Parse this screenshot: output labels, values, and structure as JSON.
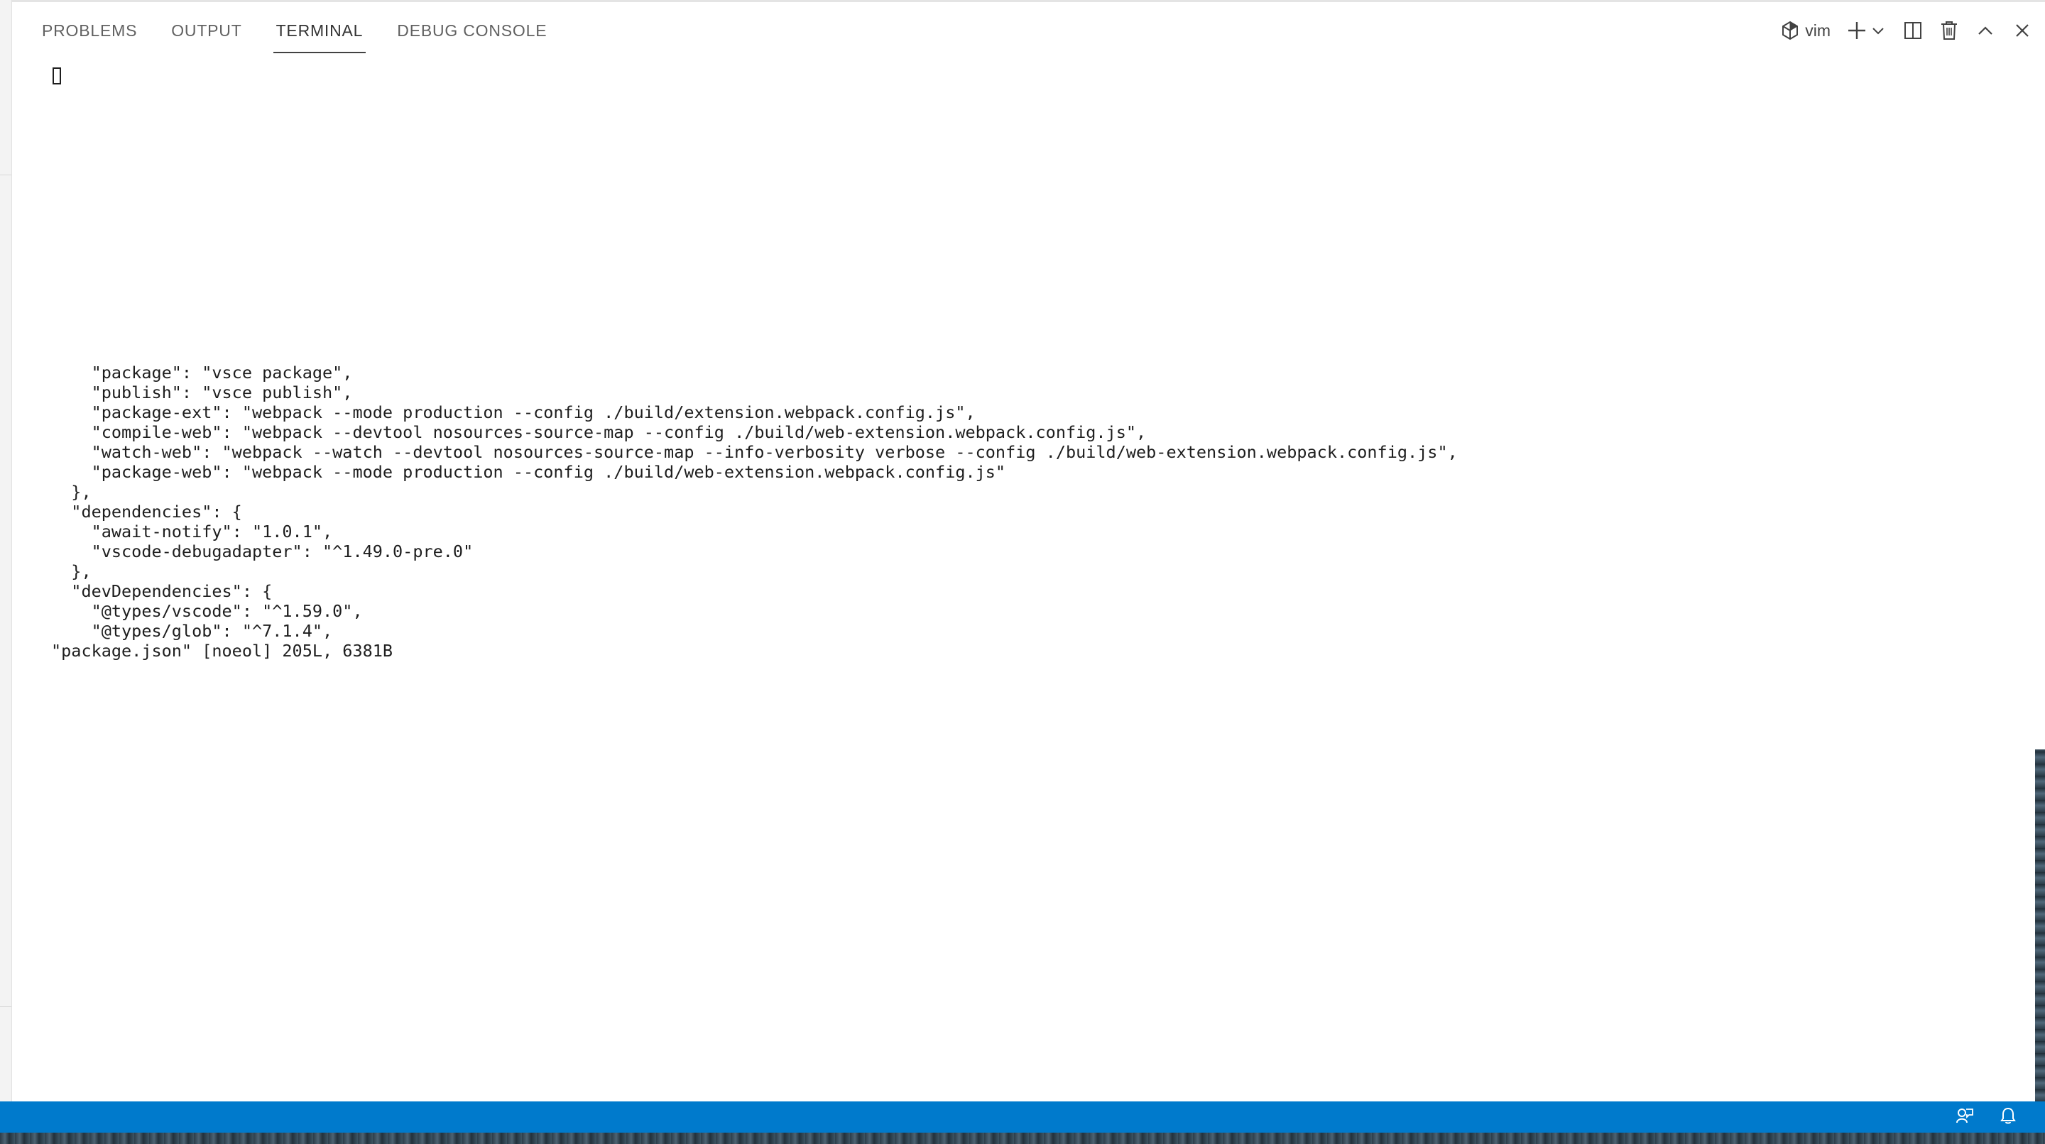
{
  "panel": {
    "tabs": [
      {
        "label": "PROBLEMS"
      },
      {
        "label": "OUTPUT"
      },
      {
        "label": "TERMINAL",
        "active": true
      },
      {
        "label": "DEBUG CONSOLE"
      }
    ],
    "actions": {
      "shell_name": "vim",
      "icons": [
        "terminal-icon",
        "plus-icon",
        "chevron-down-icon",
        "split-terminal-icon",
        "trash-icon",
        "chevron-up-icon",
        "close-icon"
      ]
    }
  },
  "terminal": {
    "lines": [
      "    \"package\": \"vsce package\",",
      "    \"publish\": \"vsce publish\",",
      "    \"package-ext\": \"webpack --mode production --config ./build/extension.webpack.config.js\",",
      "    \"compile-web\": \"webpack --devtool nosources-source-map --config ./build/web-extension.webpack.config.js\",",
      "    \"watch-web\": \"webpack --watch --devtool nosources-source-map --info-verbosity verbose --config ./build/web-extension.webpack.config.js\",",
      "    \"package-web\": \"webpack --mode production --config ./build/web-extension.webpack.config.js\"",
      "  },",
      "  \"dependencies\": {",
      "    \"await-notify\": \"1.0.1\",",
      "    \"vscode-debugadapter\": \"^1.49.0-pre.0\"",
      "  },",
      "  \"devDependencies\": {",
      "    \"@types/vscode\": \"^1.59.0\",",
      "    \"@types/glob\": \"^7.1.4\",",
      "\"package.json\" [noeol] 205L, 6381B"
    ]
  },
  "status_bar": {
    "color": "#007acc",
    "icons": [
      "feedback-icon",
      "bell-icon"
    ]
  }
}
